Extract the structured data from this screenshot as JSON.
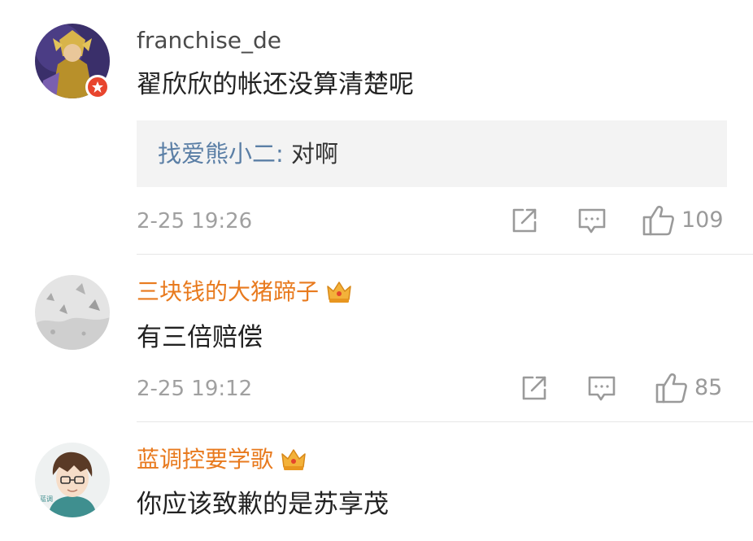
{
  "comments": [
    {
      "username": "franchise_de",
      "text": "翟欣欣的帐还没算清楚呢",
      "reply": {
        "author": "找爱熊小二",
        "separator": ":",
        "text": "对啊"
      },
      "time": "2-25 19:26",
      "likes": "109",
      "avatar_icon": "warrior-avatar",
      "badge_icon": "verified-badge-icon"
    },
    {
      "username": "三块钱的大猪蹄子",
      "text": "有三倍赔偿",
      "time": "2-25 19:12",
      "likes": "85",
      "avatar_icon": "snow-landscape-avatar",
      "vip_icon": "crown-icon"
    },
    {
      "username": "蓝调控要学歌",
      "text": "你应该致歉的是苏享茂",
      "avatar_icon": "anime-boy-avatar",
      "vip_icon": "crown-icon"
    }
  ],
  "colors": {
    "vip_name": "#e87a1e",
    "reply_name": "#5b7fa6",
    "meta": "#a0a0a0",
    "reply_bg": "#f3f3f3",
    "badge": "#e8452e"
  }
}
